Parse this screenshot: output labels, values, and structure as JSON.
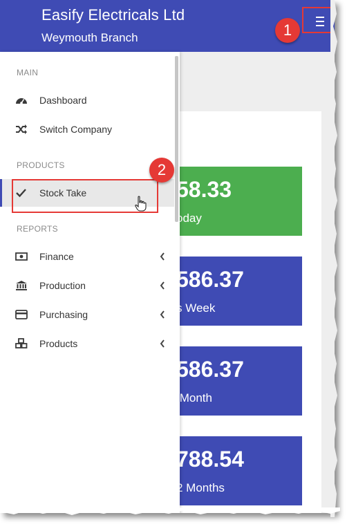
{
  "header": {
    "title": "Easify Electricals Ltd",
    "subtitle": "Weymouth Branch"
  },
  "drawer": {
    "sections": {
      "main": "MAIN",
      "products": "PRODUCTS",
      "reports": "REPORTS"
    },
    "items": {
      "dashboard": "Dashboard",
      "switch_company": "Switch Company",
      "stock_take": "Stock Take",
      "finance": "Finance",
      "production": "Production",
      "purchasing": "Purchasing",
      "products": "Products"
    }
  },
  "tiles": [
    {
      "value": "58.33",
      "label": "oday",
      "color": "#4cae4f"
    },
    {
      "value": "586.37",
      "label": "s Week",
      "color": "#3f4bb4"
    },
    {
      "value": "586.37",
      "label": " Month",
      "color": "#3f4bb4"
    },
    {
      "value": "788.54",
      "label": "2 Months",
      "color": "#3f4bb4"
    }
  ],
  "annotations": {
    "badge_1": "1",
    "badge_2": "2"
  },
  "colors": {
    "primary": "#3f4bb4",
    "success": "#4cae4f",
    "annotation_red": "#e53935"
  },
  "icons": {
    "menu": "hamburger-menu-icon",
    "dashboard": "speedometer-icon",
    "switch_company": "shuffle-icon",
    "stock_take": "check-icon",
    "finance": "money-icon",
    "production": "bank-icon",
    "purchasing": "credit-card-icon",
    "products": "cubes-icon"
  }
}
